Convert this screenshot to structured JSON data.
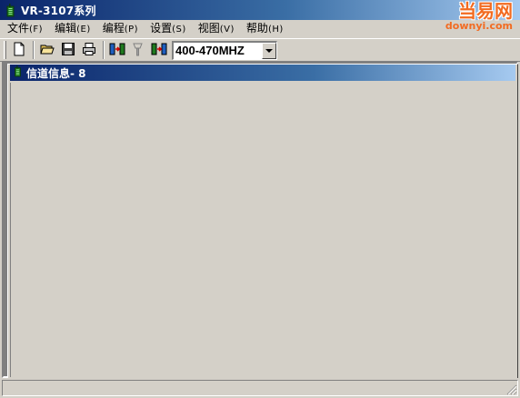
{
  "window": {
    "title": "VR-3107系列",
    "icon": "radio-icon"
  },
  "watermark": {
    "main": "当易网",
    "sub": "downyi.com"
  },
  "menu": {
    "items": [
      {
        "label": "文件",
        "mnemonic": "(F)"
      },
      {
        "label": "编辑",
        "mnemonic": "(E)"
      },
      {
        "label": "编程",
        "mnemonic": "(P)"
      },
      {
        "label": "设置",
        "mnemonic": "(S)"
      },
      {
        "label": "视图",
        "mnemonic": "(V)"
      },
      {
        "label": "帮助",
        "mnemonic": "(H)"
      }
    ]
  },
  "toolbar": {
    "buttons": [
      {
        "icon": "new-file-icon"
      },
      {
        "icon": "open-folder-icon"
      },
      {
        "icon": "save-disk-icon"
      },
      {
        "icon": "print-icon"
      },
      {
        "icon": "read-from-radio-icon"
      },
      {
        "icon": "clear-icon"
      },
      {
        "icon": "write-to-radio-icon"
      }
    ],
    "band_select": {
      "value": "400-470MHZ"
    }
  },
  "child_window": {
    "title": "信道信息- 8",
    "icon": "radio-icon"
  },
  "colors": {
    "titlebar_start": "#0a246a",
    "titlebar_end": "#a6caf0",
    "face": "#d4d0c8",
    "watermark": "#f26b21"
  }
}
